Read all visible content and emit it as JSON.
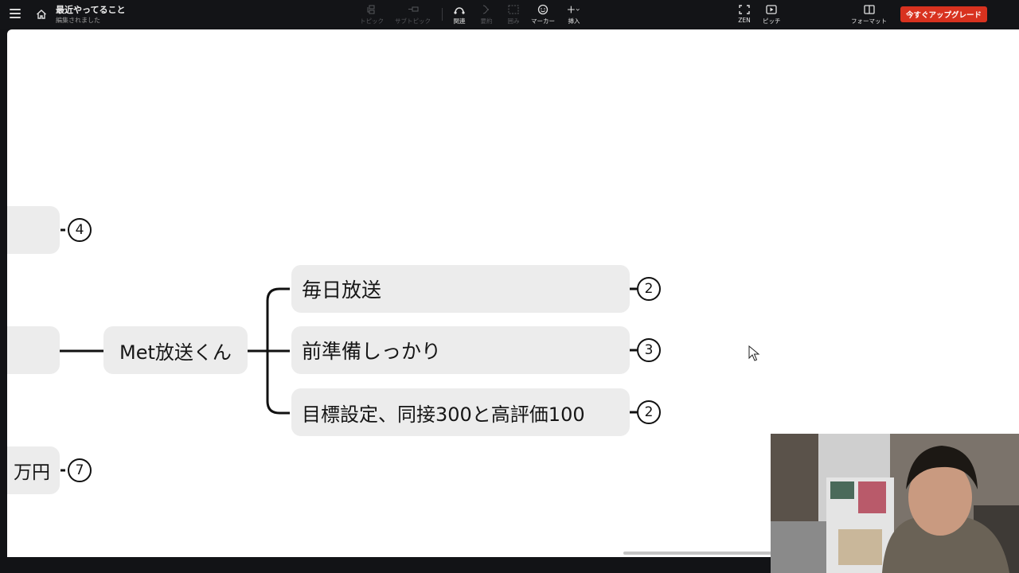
{
  "topbar": {
    "title": "最近やってること",
    "status": "編集されました",
    "tools": {
      "topic": "トピック",
      "subtopic": "サブトピック",
      "relation": "関連",
      "summary": "要約",
      "boundary": "囲み",
      "marker": "マーカー",
      "insert": "挿入",
      "zen": "ZEN",
      "pitch": "ピッチ",
      "format": "フォーマット"
    },
    "upgrade_label": "今すぐアップグレード"
  },
  "mindmap": {
    "center": "Met放送くん",
    "subtopics": [
      {
        "label": "毎日放送",
        "count": "2"
      },
      {
        "label": "前準備しっかり",
        "count": "3"
      },
      {
        "label": "目標設定、同接300と高評価100",
        "count": "2"
      }
    ],
    "left_nodes": [
      {
        "label": "",
        "count": "4"
      },
      {
        "label": "",
        "count": ""
      },
      {
        "label": "万円",
        "count": "7"
      }
    ]
  },
  "colors": {
    "topbar_bg": "#131417",
    "upgrade_bg": "#d8321f",
    "node_bg": "#ececec",
    "line": "#111111"
  }
}
